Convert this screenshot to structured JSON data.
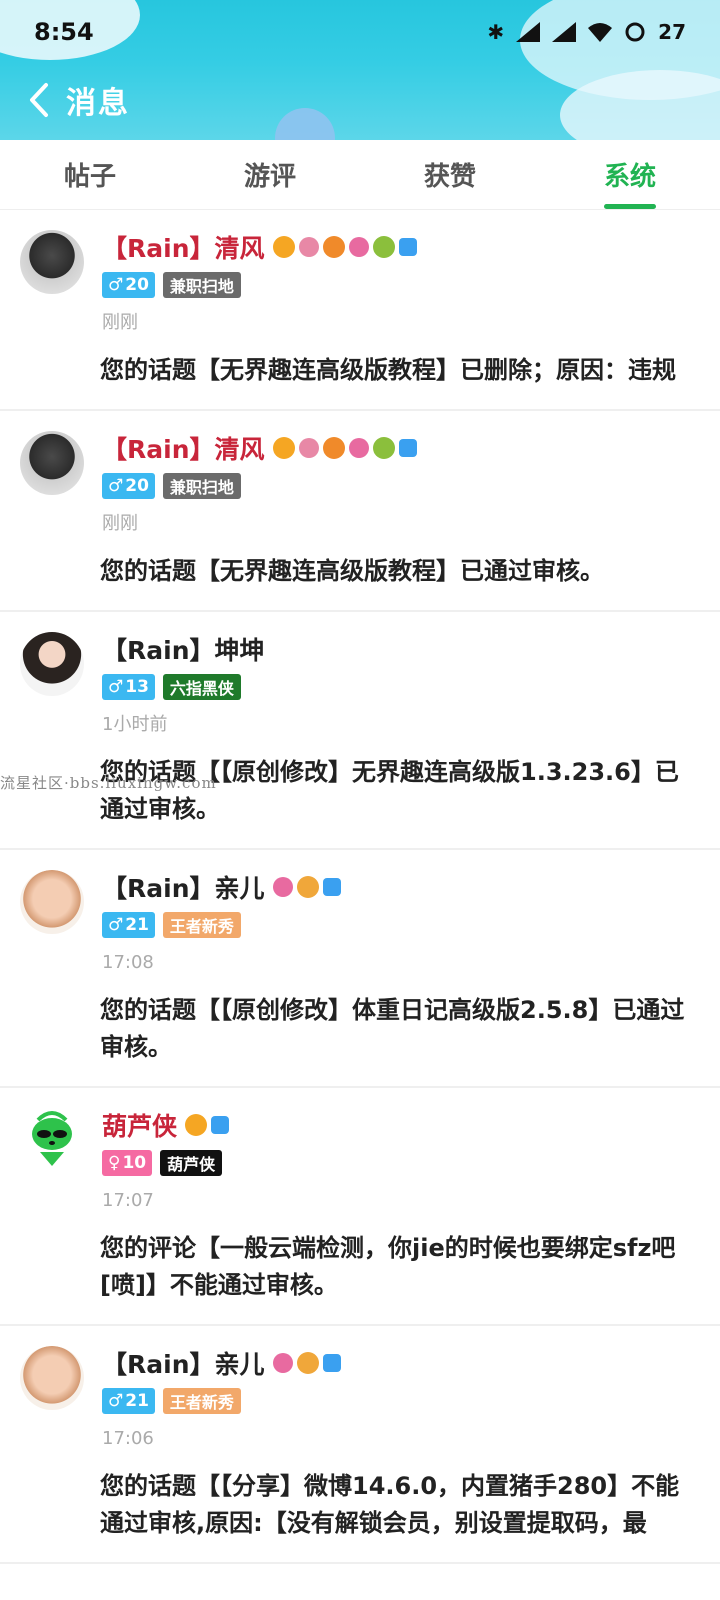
{
  "status": {
    "time": "8:54",
    "battery": "27"
  },
  "nav": {
    "title": "消息"
  },
  "tabs": [
    {
      "label": "帖子"
    },
    {
      "label": "游评"
    },
    {
      "label": "获赞"
    },
    {
      "label": "系统"
    }
  ],
  "active_tab": 3,
  "watermark": "流星社区·bbs.liuxingw.com",
  "items": [
    {
      "name": "【Rain】清风",
      "name_color": "#c8253a",
      "gender_symbol": "♂",
      "level": "20",
      "title_tag": "兼职扫地",
      "title_tag_color": "#6b6b6b",
      "time": "刚刚",
      "message": "您的话题【无界趣连高级版教程】已删除；原因：违规"
    },
    {
      "name": "【Rain】清风",
      "name_color": "#c8253a",
      "gender_symbol": "♂",
      "level": "20",
      "title_tag": "兼职扫地",
      "title_tag_color": "#6b6b6b",
      "time": "刚刚",
      "message": "您的话题【无界趣连高级版教程】已通过审核。"
    },
    {
      "name": "【Rain】坤坤",
      "name_color": "#222222",
      "gender_symbol": "♂",
      "level": "13",
      "title_tag": "六指黑侠",
      "title_tag_color": "#1f7a2b",
      "time": "1小时前",
      "message": "您的话题【【原创修改】无界趣连高级版1.3.23.6】已通过审核。"
    },
    {
      "name": "【Rain】亲儿",
      "name_color": "#222222",
      "gender_symbol": "♂",
      "level": "21",
      "title_tag": "王者新秀",
      "title_tag_color": "#f2a86a",
      "time": "17:08",
      "message": "您的话题【【原创修改】体重日记高级版2.5.8】已通过审核。"
    },
    {
      "name": "葫芦侠",
      "name_color": "#c8253a",
      "gender_symbol": "♀",
      "level": "10",
      "title_tag": "葫芦侠",
      "title_tag_color": "#111111",
      "time": "17:07",
      "message": "您的评论【一般云端检测，你jie的时候也要绑定sfz吧[喷]】不能通过审核。"
    },
    {
      "name": "【Rain】亲儿",
      "name_color": "#222222",
      "gender_symbol": "♂",
      "level": "21",
      "title_tag": "王者新秀",
      "title_tag_color": "#f2a86a",
      "time": "17:06",
      "message": "您的话题【【分享】微博14.6.0，内置猪手280】不能通过审核,原因:【没有解锁会员，别设置提取码，最"
    }
  ]
}
